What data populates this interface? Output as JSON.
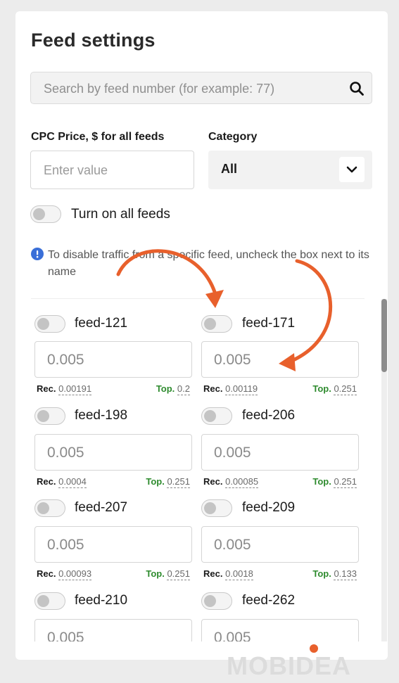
{
  "panel": {
    "title": "Feed settings",
    "search": {
      "placeholder": "Search by feed number (for example: 77)"
    },
    "cpc": {
      "label": "CPC Price, $ for all feeds",
      "placeholder": "Enter value"
    },
    "category": {
      "label": "Category",
      "value": "All"
    },
    "all_feeds_toggle": {
      "label": "Turn on all feeds",
      "on": false
    },
    "info": "To disable traffic from a specific feed, uncheck the box next to its name",
    "rec_label": "Rec.",
    "top_label": "Top."
  },
  "feeds": [
    {
      "name": "feed-121",
      "price": "0.005",
      "rec": "0.00191",
      "top": "0.2",
      "on": false
    },
    {
      "name": "feed-171",
      "price": "0.005",
      "rec": "0.00119",
      "top": "0.251",
      "on": false
    },
    {
      "name": "feed-198",
      "price": "0.005",
      "rec": "0.0004",
      "top": "0.251",
      "on": false
    },
    {
      "name": "feed-206",
      "price": "0.005",
      "rec": "0.00085",
      "top": "0.251",
      "on": false
    },
    {
      "name": "feed-207",
      "price": "0.005",
      "rec": "0.00093",
      "top": "0.251",
      "on": false
    },
    {
      "name": "feed-209",
      "price": "0.005",
      "rec": "0.0018",
      "top": "0.133",
      "on": false
    },
    {
      "name": "feed-210",
      "price": "0.005",
      "rec": "",
      "top": "",
      "on": false
    },
    {
      "name": "feed-262",
      "price": "0.005",
      "rec": "",
      "top": "",
      "on": false
    }
  ],
  "watermark": "MOBIDEA",
  "colors": {
    "accent_arrow": "#e8602c",
    "top_green": "#2e8b2e",
    "info_blue": "#3a6fd8"
  }
}
